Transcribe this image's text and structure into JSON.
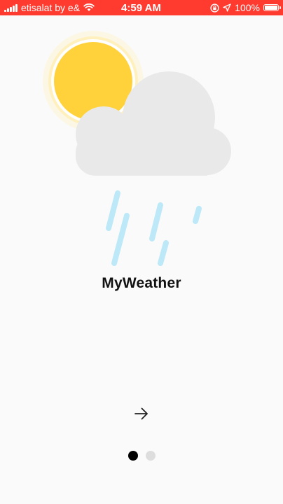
{
  "status_bar": {
    "carrier": "etisalat by e&",
    "time": "4:59 AM",
    "battery": "100%",
    "battery_level": 1.0,
    "icons": [
      "signal-icon",
      "wifi-icon",
      "rotation-lock-icon",
      "location-icon",
      "battery-icon"
    ]
  },
  "splash": {
    "app_name": "MyWeather",
    "illustration": "sun-cloud-rain-icon",
    "next_icon": "arrow-right-icon"
  },
  "pager": {
    "pages": 2,
    "current": 1
  },
  "colors": {
    "status_bar": "#ff3b30",
    "sun": "#ffd23c",
    "cloud": "#e9e9e9",
    "rain": "#bce8f7",
    "background": "#fafafa"
  }
}
